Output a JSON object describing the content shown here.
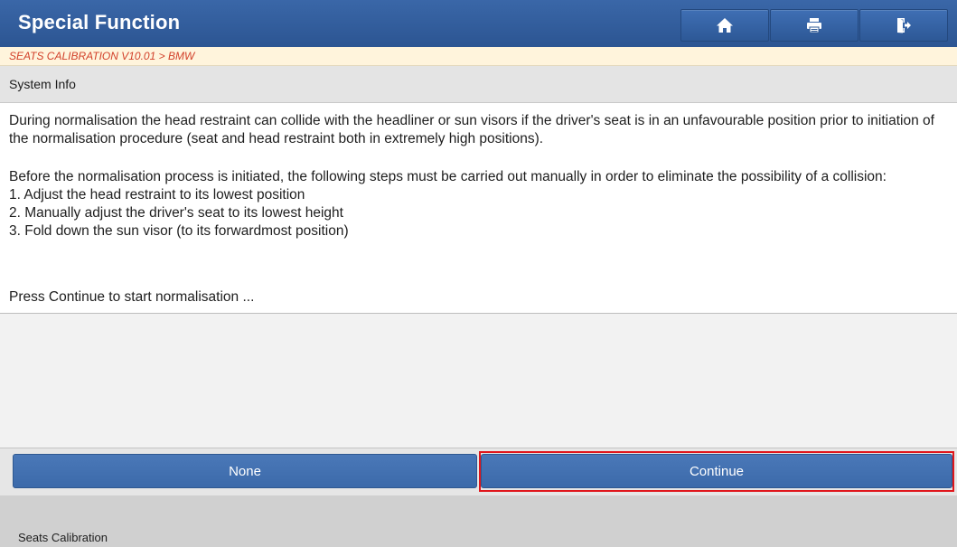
{
  "header": {
    "title": "Special Function",
    "buttons": [
      {
        "icon": "home-icon"
      },
      {
        "icon": "print-icon"
      },
      {
        "icon": "exit-icon"
      }
    ]
  },
  "breadcrumb": "SEATS CALIBRATION V10.01 > BMW",
  "section": {
    "title": "System Info"
  },
  "message": {
    "paragraph1": "During normalisation the head restraint can collide with the headliner or sun visors if the driver's seat is in an unfavourable position prior to initiation of the normalisation procedure (seat and head restraint both in extremely high positions).",
    "paragraph2_intro": "Before the normalisation process is initiated, the following steps must be carried out manually in order to eliminate the possibility of a collision:",
    "steps": [
      "1. Adjust the head restraint to its lowest position",
      "2. Manually adjust the driver's seat to its lowest height",
      "3. Fold down the sun visor (to its forwardmost position)"
    ],
    "prompt": "Press Continue to start normalisation ..."
  },
  "actions": {
    "none_label": "None",
    "continue_label": "Continue"
  },
  "status": {
    "label": "Seats Calibration"
  },
  "colors": {
    "header_blue": "#2c5592",
    "button_blue": "#4a78b8",
    "breadcrumb_text": "#d2402a",
    "highlight_red": "#e0161c"
  }
}
